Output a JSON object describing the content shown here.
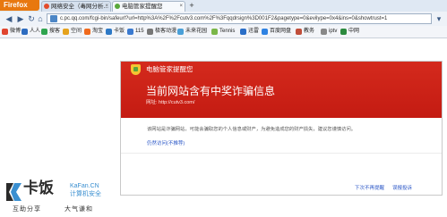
{
  "browser": {
    "app_button": "Firefox",
    "tabs": [
      {
        "label": "网络安全（毒网分析...",
        "active": false,
        "favicon_color": "#e34b2a"
      },
      {
        "label": "电脑管家提醒您",
        "active": true,
        "favicon_color": "#59a83b"
      }
    ],
    "new_tab_label": "+",
    "url": "c.pc.qq.com/fcgi-bin/safeurl?url=http%3A%2F%2Fcutv3.com%2F%3Fqqdrsign%3D001F2&pagetype=0&evilype=0x4&ins=0&showtrust=1",
    "bookmarks": [
      {
        "label": "微博",
        "color": "#e0452f"
      },
      {
        "label": "人人",
        "color": "#2d6cc0"
      },
      {
        "label": "搜客",
        "color": "#2fa44f"
      },
      {
        "label": "空间",
        "color": "#e5a21d"
      },
      {
        "label": "淘宝",
        "color": "#f06a1d"
      },
      {
        "label": "卡饭",
        "color": "#2d79c6"
      },
      {
        "label": "115",
        "color": "#3a7ad0"
      },
      {
        "label": "极客动漫",
        "color": "#777777"
      },
      {
        "label": "未来花园",
        "color": "#4aa0d8"
      },
      {
        "label": "Tennis",
        "color": "#7ab648"
      },
      {
        "label": "迅雷",
        "color": "#2a6ec7"
      },
      {
        "label": "百度网盘",
        "color": "#2f82e2"
      },
      {
        "label": "教务",
        "color": "#c04e3a"
      },
      {
        "label": "iptv",
        "color": "#888888"
      },
      {
        "label": "中网",
        "color": "#2c8a3e"
      }
    ]
  },
  "warning": {
    "brand": "电脑管家提醒您",
    "headline": "当前网站含有中奖诈骗信息",
    "url_line": "网址: http://cutv3.com/",
    "description": "该网站是诈骗网站，可能会骗取您的个人信息或财产，为避免造成您的财产损失，建议您谨慎访问。",
    "continue_link": "仍然访问(不推荐)",
    "no_remind_link": "下次不再提醒",
    "report_link": "误报投诉",
    "header_color": "#c8201a"
  },
  "watermark": {
    "logo_text": "卡饭",
    "logo_en": "KaFan.CN",
    "logo_cn": "计算机安全",
    "slogan_left": "互助分享",
    "slogan_right": "大气谦和"
  }
}
